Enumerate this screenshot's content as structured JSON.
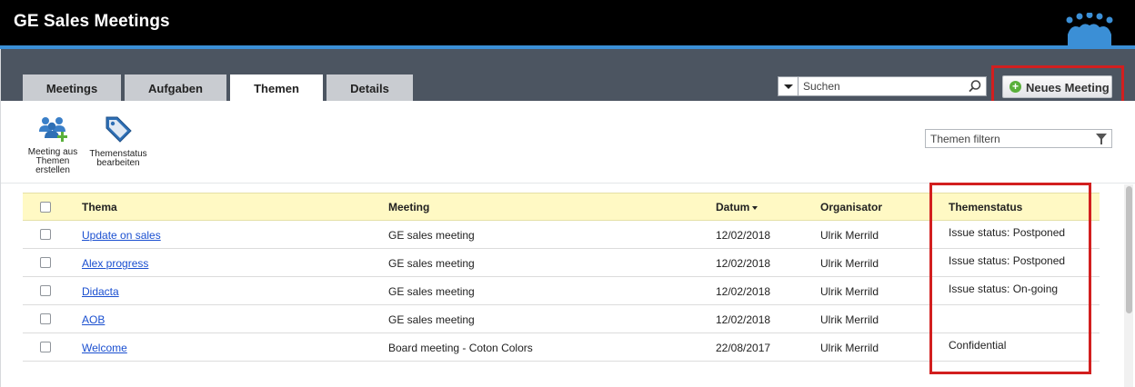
{
  "app": {
    "title": "GE Sales Meetings"
  },
  "tabs": [
    {
      "label": "Meetings"
    },
    {
      "label": "Aufgaben"
    },
    {
      "label": "Themen"
    },
    {
      "label": "Details"
    }
  ],
  "search": {
    "placeholder": "Suchen"
  },
  "new_meeting_button": {
    "label": "Neues Meeting"
  },
  "toolbar": {
    "create_meeting": {
      "line1": "Meeting aus",
      "line2": "Themen",
      "line3": "erstellen",
      "icon": "people-add-icon"
    },
    "edit_status": {
      "line1": "Themenstatus",
      "line2": "bearbeiten",
      "icon": "tag-icon"
    }
  },
  "filter": {
    "placeholder": "Themen filtern"
  },
  "table": {
    "headers": {
      "topic": "Thema",
      "meeting": "Meeting",
      "date": "Datum",
      "organizer": "Organisator",
      "status": "Themenstatus"
    },
    "rows": [
      {
        "topic": "Update on sales",
        "meeting": "GE sales meeting",
        "date": "12/02/2018",
        "organizer": "Ulrik Merrild",
        "status": "Issue status: Postponed"
      },
      {
        "topic": "Alex progress",
        "meeting": "GE sales meeting",
        "date": "12/02/2018",
        "organizer": "Ulrik Merrild",
        "status": "Issue status: Postponed"
      },
      {
        "topic": "Didacta",
        "meeting": "GE sales meeting",
        "date": "12/02/2018",
        "organizer": "Ulrik Merrild",
        "status": "Issue status: On-going"
      },
      {
        "topic": "AOB",
        "meeting": "GE sales meeting",
        "date": "12/02/2018",
        "organizer": "Ulrik Merrild",
        "status": ""
      },
      {
        "topic": "Welcome",
        "meeting": "Board meeting - Coton Colors",
        "date": "22/08/2017",
        "organizer": "Ulrik Merrild",
        "status": "Confidential"
      }
    ]
  },
  "colors": {
    "header_bg": "#000000",
    "accent_line": "#3b8fd6",
    "tabbar_bg": "#4c5561",
    "table_header_bg": "#fff9c4",
    "highlight": "#d21f1f",
    "link": "#1a4fd0"
  }
}
